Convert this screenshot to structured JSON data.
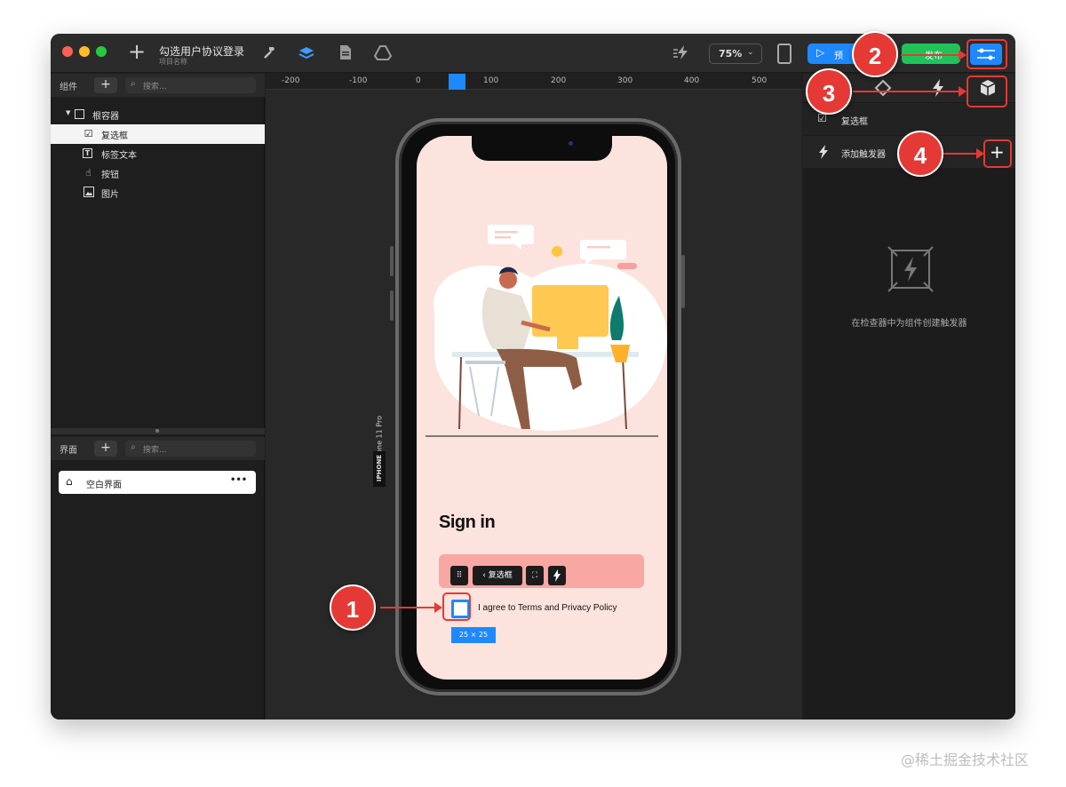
{
  "window": {
    "title": "勾选用户协议登录",
    "subtitle": "项目名称",
    "zoom": "75%",
    "preview_label": "预",
    "publish_label": "发布"
  },
  "left_panel": {
    "components_section": {
      "label": "组件",
      "search_placeholder": "搜索...",
      "tree": [
        {
          "label": "根容器",
          "icon": "container-icon"
        },
        {
          "label": "复选框",
          "icon": "checkbox-icon",
          "selected": true
        },
        {
          "label": "标签文本",
          "icon": "text-icon"
        },
        {
          "label": "按钮",
          "icon": "hand-pointer-icon"
        },
        {
          "label": "图片",
          "icon": "image-icon"
        }
      ]
    },
    "screens_section": {
      "label": "界面",
      "search_placeholder": "搜索...",
      "screens": [
        {
          "label": "空白界面",
          "icon": "home-icon",
          "more": "•••"
        }
      ]
    }
  },
  "ruler": {
    "labels": [
      "-200",
      "-100",
      "0",
      "100",
      "200",
      "300",
      "400",
      "500"
    ]
  },
  "device_label": {
    "name": "iPhone 11 Pro",
    "family": "IPHONE"
  },
  "phone_screen": {
    "heading": "Sign in",
    "checkbox_label": "I agree to Terms and Privacy Policy",
    "size_tag": "25 × 25",
    "toolbar_label": "复选框"
  },
  "right_panel": {
    "component_name": "复选框",
    "add_trigger_label": "添加触发器",
    "empty_hint": "在检查器中为组件创建触发器"
  },
  "annotations": [
    "1",
    "2",
    "3",
    "4"
  ],
  "watermark": "@稀土掘金技术社区",
  "colors": {
    "accent_blue": "#1e88ff",
    "publish_green": "#1fc35a",
    "annotation_red": "#e53935",
    "screen_bg": "#fde3dd",
    "input_pink": "#f9a7a3"
  }
}
